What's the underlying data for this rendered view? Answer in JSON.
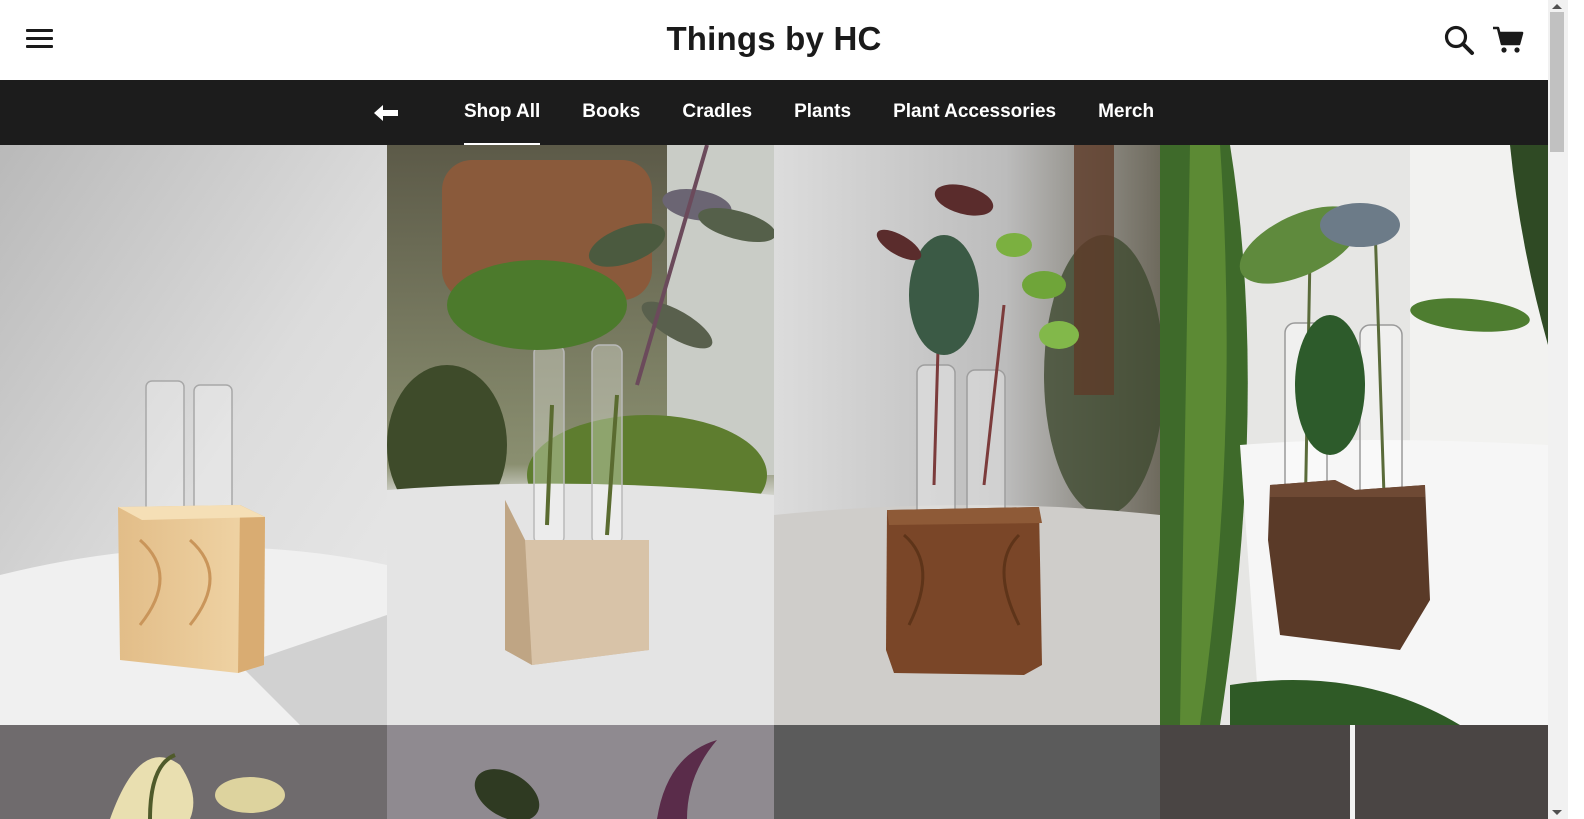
{
  "header": {
    "title": "Things by HC",
    "menu_icon": "hamburger-menu-icon",
    "search_icon": "search-icon",
    "cart_icon": "cart-icon"
  },
  "nav": {
    "back_icon": "arrow-left-icon",
    "items": [
      {
        "label": "Shop All",
        "active": true
      },
      {
        "label": "Books",
        "active": false
      },
      {
        "label": "Cradles",
        "active": false
      },
      {
        "label": "Plants",
        "active": false
      },
      {
        "label": "Plant Accessories",
        "active": false
      },
      {
        "label": "Merch",
        "active": false
      }
    ]
  },
  "colors": {
    "nav_background": "#1c1c1c",
    "header_background": "#ffffff",
    "title_text": "#1a1a1a"
  }
}
